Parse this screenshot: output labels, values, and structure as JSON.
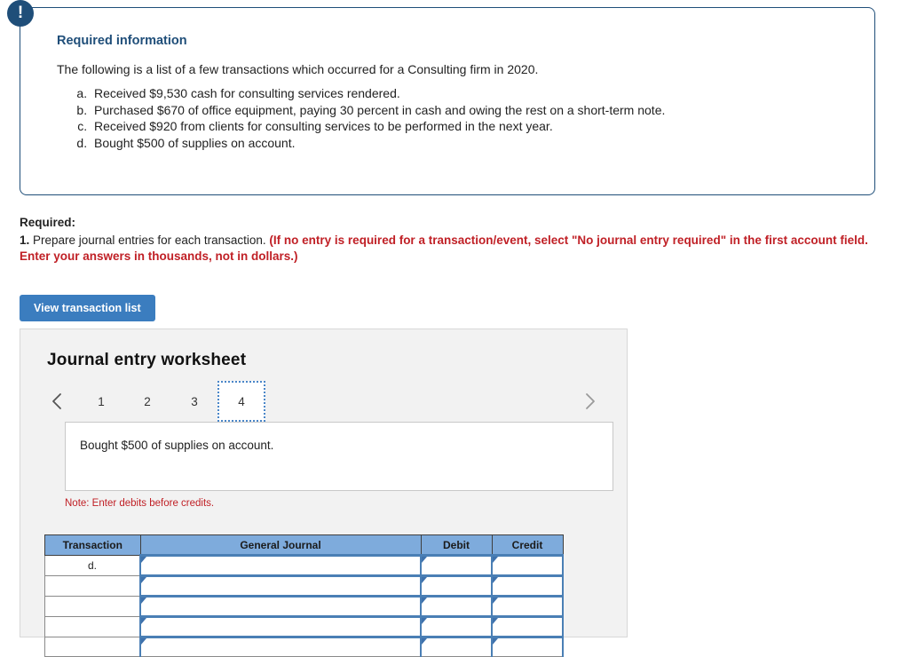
{
  "alert": {
    "icon": "exclamation-icon",
    "glyph": "!"
  },
  "required_information": {
    "title": "Required information",
    "lead": "The following is a list of a few transactions which occurred for a Consulting firm in 2020.",
    "transactions": [
      "Received $9,530 cash for consulting services rendered.",
      "Purchased $670 of office equipment, paying 30 percent in cash and owing the rest on a short-term note.",
      "Received $920 from clients for consulting services to be performed in the next year.",
      "Bought $500 of supplies on account."
    ]
  },
  "required_section": {
    "label": "Required:",
    "number": "1.",
    "instruction": " Prepare journal entries for each transaction. ",
    "emphasis": "(If no entry is required for a transaction/event, select \"No journal entry required\" in the first account field. Enter your answers in thousands, not in dollars.)"
  },
  "buttons": {
    "view_transaction_list": "View transaction list"
  },
  "worksheet": {
    "title": "Journal entry worksheet",
    "pager": {
      "prev_icon": "chevron-left-icon",
      "next_icon": "chevron-right-icon",
      "tabs": [
        "1",
        "2",
        "3",
        "4"
      ],
      "active_tab": "4"
    },
    "description": "Bought $500 of supplies on account.",
    "note": "Note: Enter debits before credits.",
    "table": {
      "headers": [
        "Transaction",
        "General Journal",
        "Debit",
        "Credit"
      ],
      "rows": [
        {
          "transaction": "d.",
          "general_journal": "",
          "debit": "",
          "credit": ""
        },
        {
          "transaction": "",
          "general_journal": "",
          "debit": "",
          "credit": ""
        },
        {
          "transaction": "",
          "general_journal": "",
          "debit": "",
          "credit": ""
        },
        {
          "transaction": "",
          "general_journal": "",
          "debit": "",
          "credit": ""
        },
        {
          "transaction": "",
          "general_journal": "",
          "debit": "",
          "credit": ""
        }
      ]
    }
  },
  "colors": {
    "panel_border": "#1f4e79",
    "badge": "#1f4e79",
    "title_blue": "#1f4e79",
    "button_blue": "#3b7dbf",
    "alert_red": "#c02026",
    "table_header_blue": "#7eabdc",
    "input_border_blue": "#4a7fb5",
    "panel_bg": "#f2f2f2"
  }
}
